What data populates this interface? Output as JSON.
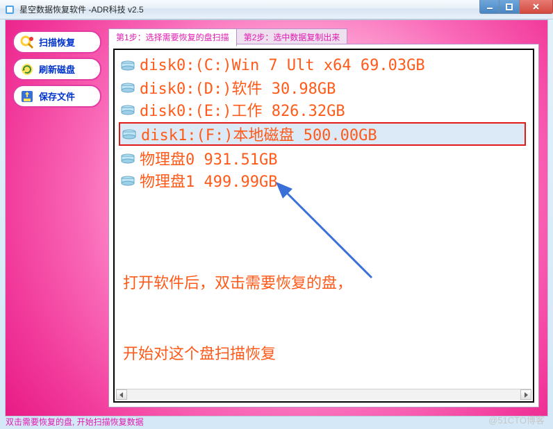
{
  "window": {
    "title": "星空数据恢复软件   -ADR科技 v2.5"
  },
  "sidebar": {
    "items": [
      {
        "label": "扫描恢复",
        "icon": "scan-icon"
      },
      {
        "label": "刷新磁盘",
        "icon": "refresh-icon"
      },
      {
        "label": "保存文件",
        "icon": "save-icon"
      }
    ]
  },
  "tabs": [
    {
      "label": "第1步：选择需要恢复的盘扫描",
      "active": true
    },
    {
      "label": "第2步：选中数据复制出来",
      "active": false
    }
  ],
  "disks": [
    {
      "text": "disk0:(C:)Win 7 Ult x64 69.03GB",
      "selected": false
    },
    {
      "text": "disk0:(D:)软件 30.98GB",
      "selected": false
    },
    {
      "text": "disk0:(E:)工作 826.32GB",
      "selected": false
    },
    {
      "text": "disk1:(F:)本地磁盘 500.00GB",
      "selected": true
    },
    {
      "text": "物理盘0 931.51GB",
      "selected": false
    },
    {
      "text": "物理盘1 499.99GB",
      "selected": false
    }
  ],
  "annotation": {
    "line1": "打开软件后，双击需要恢复的盘，",
    "line2": "开始对这个盘扫描恢复"
  },
  "status_text": "双击需要恢复的盘, 开始扫描恢复数据",
  "watermark": "@51CTO博客",
  "colors": {
    "accent_pink": "#e11bb0",
    "disk_text": "#ff5a19",
    "select_border": "#e21919",
    "arrow": "#3a6fd8"
  }
}
